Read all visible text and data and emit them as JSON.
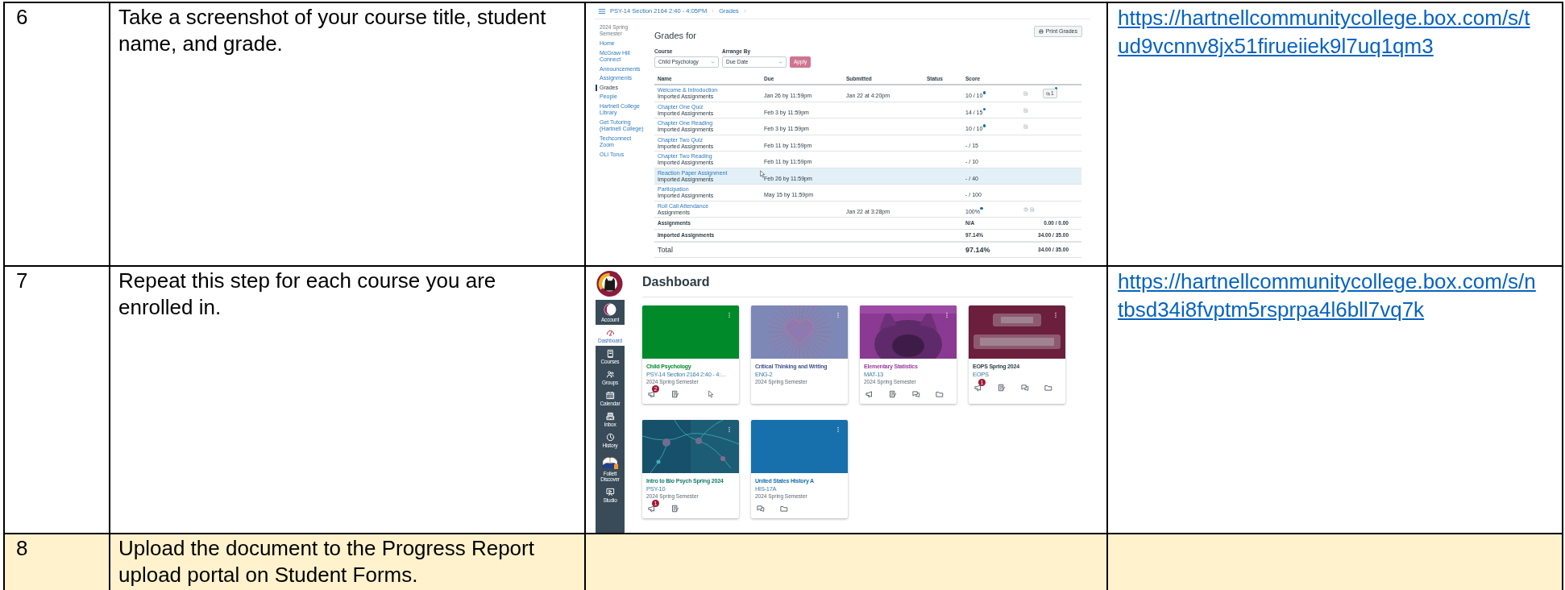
{
  "rows": [
    {
      "step": "6",
      "instruction": "Take a screenshot of your course title, student name, and grade.",
      "link": "https://hartnellcommunitycollege.box.com/s/tud9vcnnv8jx51firueiiek9l7uq1qm3",
      "highlighted": false,
      "screenshot": {
        "kind": "grades",
        "breadcrumb": [
          "PSY-14 Section 2164 2:40 - 4:05PM",
          "Grades"
        ],
        "term": "2024 Spring Semester",
        "nav": [
          {
            "label": "Home",
            "selected": false
          },
          {
            "label": "McGraw Hill Connect",
            "selected": false
          },
          {
            "label": "Announcements",
            "selected": false
          },
          {
            "label": "Assignments",
            "selected": false
          },
          {
            "label": "Grades",
            "selected": true
          },
          {
            "label": "People",
            "selected": false
          },
          {
            "label": "Hartnell College Library",
            "selected": false
          },
          {
            "label": "Get Tutoring (Hartnell College)",
            "selected": false
          },
          {
            "label": "Techconnect Zoom",
            "selected": false
          },
          {
            "label": "OLI Torus",
            "selected": false
          }
        ],
        "heading": "Grades for",
        "print_button": "Print Grades",
        "course_label": "Course",
        "course_value": "Child Psychology",
        "arrange_label": "Arrange By",
        "arrange_value": "Due Date",
        "apply_button": "Apply",
        "columns": [
          "Name",
          "Due",
          "Submitted",
          "Status",
          "Score"
        ],
        "assignments": [
          {
            "name": "Welcome & Introduction",
            "group": "Imported Assignments",
            "due": "Jan 26 by 11:59pm",
            "submitted": "Jan 22 at 4:20pm",
            "score": "10 / 10",
            "unread": true,
            "selected": false,
            "details_icon": true,
            "info_icon": false,
            "comments": "1"
          },
          {
            "name": "Chapter One Quiz",
            "group": "Imported Assignments",
            "due": "Feb 3 by 11:59pm",
            "score": "14 / 15",
            "unread": true,
            "selected": false,
            "details_icon": true,
            "info_icon": false
          },
          {
            "name": "Chapter One Reading",
            "group": "Imported Assignments",
            "due": "Feb 3 by 11:59pm",
            "score": "10 / 10",
            "unread": true,
            "selected": false,
            "details_icon": true,
            "info_icon": false
          },
          {
            "name": "Chapter Two Quiz",
            "group": "Imported Assignments",
            "due": "Feb 11 by 11:59pm",
            "score": "- / 15",
            "unread": false,
            "selected": false,
            "details_icon": false,
            "info_icon": false
          },
          {
            "name": "Chapter Two Reading",
            "group": "Imported Assignments",
            "due": "Feb 11 by 11:59pm",
            "score": "- / 10",
            "unread": false,
            "selected": false,
            "details_icon": false,
            "info_icon": false
          },
          {
            "name": "Reaction Paper Assignment",
            "group": "Imported Assignments",
            "due": "Feb 26 by 11:59pm",
            "score": "- / 40",
            "unread": false,
            "selected": true,
            "details_icon": false,
            "info_icon": false
          },
          {
            "name": "Participation",
            "group": "Imported Assignments",
            "due": "May 15 by 11:59pm",
            "score": "- / 100",
            "unread": false,
            "selected": false,
            "details_icon": false,
            "info_icon": false
          },
          {
            "name": "Roll Call Attendance",
            "group": "Assignments",
            "submitted": "Jan 22 at 3:28pm",
            "score": "100%",
            "unread": true,
            "selected": false,
            "details_icon": true,
            "info_icon": true
          }
        ],
        "totals": [
          {
            "kind": "group",
            "label": "Assignments",
            "score": "N/A",
            "points": "0.00 / 0.00"
          },
          {
            "kind": "group",
            "label": "Imported Assignments",
            "score": "97.14%",
            "points": "34.00 / 35.00"
          },
          {
            "kind": "total",
            "label": "Total",
            "score": "97.14%",
            "points": "34.00 / 35.00"
          }
        ]
      }
    },
    {
      "step": "7",
      "instruction": "Repeat this step for each course you are enrolled in.",
      "link": "https://hartnellcommunitycollege.box.com/s/ntbsd34i8fvptm5rsprpa4l6bll7vq7k",
      "highlighted": false,
      "screenshot": {
        "kind": "dashboard",
        "nav": [
          {
            "kind": "account",
            "label": "Account",
            "selected": false
          },
          {
            "kind": "dashboard",
            "label": "Dashboard",
            "selected": true
          },
          {
            "kind": "courses",
            "label": "Courses",
            "selected": false
          },
          {
            "kind": "groups",
            "label": "Groups",
            "selected": false
          },
          {
            "kind": "calendar",
            "label": "Calendar",
            "selected": false
          },
          {
            "kind": "inbox",
            "label": "Inbox",
            "selected": false
          },
          {
            "kind": "history",
            "label": "History",
            "selected": false
          },
          {
            "kind": "book",
            "label": "Follett Discover",
            "selected": false
          },
          {
            "kind": "studio",
            "label": "Studio",
            "selected": false
          }
        ],
        "heading": "Dashboard",
        "cards": [
          {
            "title": "Child Psychology",
            "code": "PSY-14 Section 2164 2:40 - 4:…",
            "term": "2024 Spring Semester",
            "color": "#008a2a",
            "icons": [
              {
                "kind": "announcements",
                "badge": "2"
              },
              {
                "kind": "assignments"
              }
            ]
          },
          {
            "title": "Critical Thinking and Writing",
            "code": "ENG-2",
            "term": "2024 Spring Semester",
            "color": "#44528a",
            "kind": "picture"
          },
          {
            "title": "Elementary Statistics",
            "code": "MAT-13",
            "term": "2024 Spring Semester",
            "color": "#9c3aa0",
            "kind": "picture",
            "icons": [
              {
                "kind": "announcements"
              },
              {
                "kind": "assignments"
              },
              {
                "kind": "discussions"
              },
              {
                "kind": "files"
              }
            ]
          },
          {
            "title": "EOPS Spring 2024",
            "code": "EOPS",
            "color": "#2d3b45",
            "kind": "picture",
            "icons": [
              {
                "kind": "announcements",
                "badge": "1"
              },
              {
                "kind": "assignments"
              },
              {
                "kind": "discussions"
              },
              {
                "kind": "files"
              }
            ]
          },
          {
            "title": "Intro to Bio Psych Spring 2024",
            "code": "PSY-10",
            "term": "2024 Spring Semester",
            "color": "#127c6b",
            "kind": "picture",
            "icons": [
              {
                "kind": "announcements",
                "badge": "1"
              },
              {
                "kind": "assignments"
              }
            ]
          },
          {
            "title": "United States History A",
            "code": "HIS-17A",
            "term": "2024 Spring Semester",
            "color": "#1770ab",
            "icons": [
              {
                "kind": "discussions"
              },
              {
                "kind": "files"
              }
            ]
          }
        ]
      }
    },
    {
      "step": "8",
      "instruction": "Upload the document to the Progress Report upload portal on Student Forms.",
      "highlighted": true
    }
  ]
}
